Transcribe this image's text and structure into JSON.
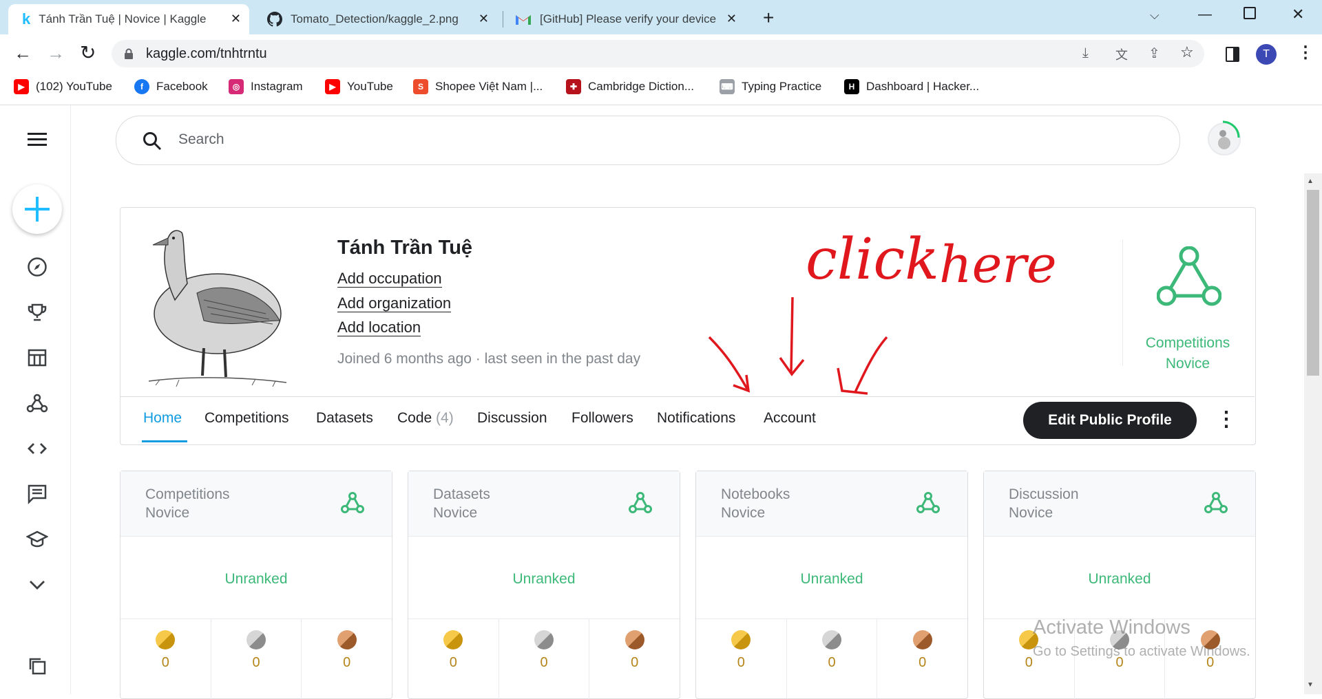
{
  "tabs": [
    {
      "title": "Tánh Trần Tuệ | Novice | Kaggle",
      "icon": "kaggle-icon"
    },
    {
      "title": "Tomato_Detection/kaggle_2.png",
      "icon": "github-icon"
    },
    {
      "title": "[GitHub] Please verify your device",
      "icon": "gmail-icon"
    }
  ],
  "address": "kaggle.com/tnhtrntu",
  "profile_initial": "T",
  "bookmarks": [
    {
      "label": "(102) YouTube",
      "icon": "youtube-icon"
    },
    {
      "label": "Facebook",
      "icon": "facebook-icon"
    },
    {
      "label": "Instagram",
      "icon": "instagram-icon"
    },
    {
      "label": "YouTube",
      "icon": "youtube-icon"
    },
    {
      "label": "Shopee Việt Nam |...",
      "icon": "shopee-icon"
    },
    {
      "label": "Cambridge Diction...",
      "icon": "cambridge-icon"
    },
    {
      "label": "Typing Practice",
      "icon": "typing-icon"
    },
    {
      "label": "Dashboard | Hacker...",
      "icon": "hackerrank-icon"
    }
  ],
  "search": {
    "placeholder": "Search"
  },
  "profile": {
    "name": "Tánh Trần Tuệ",
    "add_occupation": "Add occupation",
    "add_organization": "Add organization",
    "add_location": "Add location",
    "joined": "Joined 6 months ago · last seen in the past day",
    "tier_line1": "Competitions",
    "tier_line2": "Novice"
  },
  "annotation": {
    "line1": "click",
    "line2": "here"
  },
  "nav_tabs": [
    {
      "label": "Home"
    },
    {
      "label": "Competitions"
    },
    {
      "label": "Datasets"
    },
    {
      "label": "Code"
    },
    {
      "label": "Discussion"
    },
    {
      "label": "Followers"
    },
    {
      "label": "Notifications"
    },
    {
      "label": "Account"
    }
  ],
  "code_count": "(4)",
  "edit_button": "Edit Public Profile",
  "stats": [
    {
      "line1": "Competitions",
      "line2": "Novice",
      "rank": "Unranked",
      "gold": "0",
      "silver": "0",
      "bronze": "0"
    },
    {
      "line1": "Datasets",
      "line2": "Novice",
      "rank": "Unranked",
      "gold": "0",
      "silver": "0",
      "bronze": "0"
    },
    {
      "line1": "Notebooks",
      "line2": "Novice",
      "rank": "Unranked",
      "gold": "0",
      "silver": "0",
      "bronze": "0"
    },
    {
      "line1": "Discussion",
      "line2": "Novice",
      "rank": "Unranked",
      "gold": "0",
      "silver": "0",
      "bronze": "0"
    }
  ],
  "watermark": {
    "line1": "Activate Windows",
    "line2": "Go to Settings to activate Windows."
  },
  "colors": {
    "accent": "#20beff",
    "tier": "#3cb878",
    "tab_active": "#0f9ce0",
    "annotation": "#e0181e"
  }
}
